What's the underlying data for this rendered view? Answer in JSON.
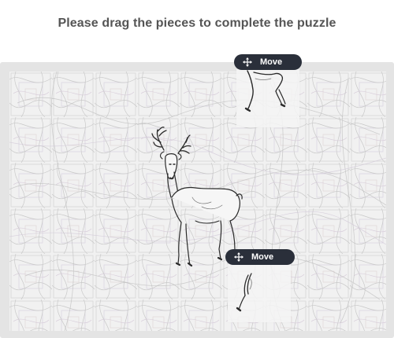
{
  "instruction": "Please drag the pieces to complete the puzzle",
  "pieces": [
    {
      "move_label": "Move",
      "icon": "move-arrows-icon"
    },
    {
      "move_label": "Move",
      "icon": "move-arrows-icon"
    }
  ],
  "colors": {
    "title": "#555555",
    "frame": "#e4e4e4",
    "board": "#f3f3f3",
    "handle": "#2a2f3a",
    "handle_text": "#ffffff"
  }
}
